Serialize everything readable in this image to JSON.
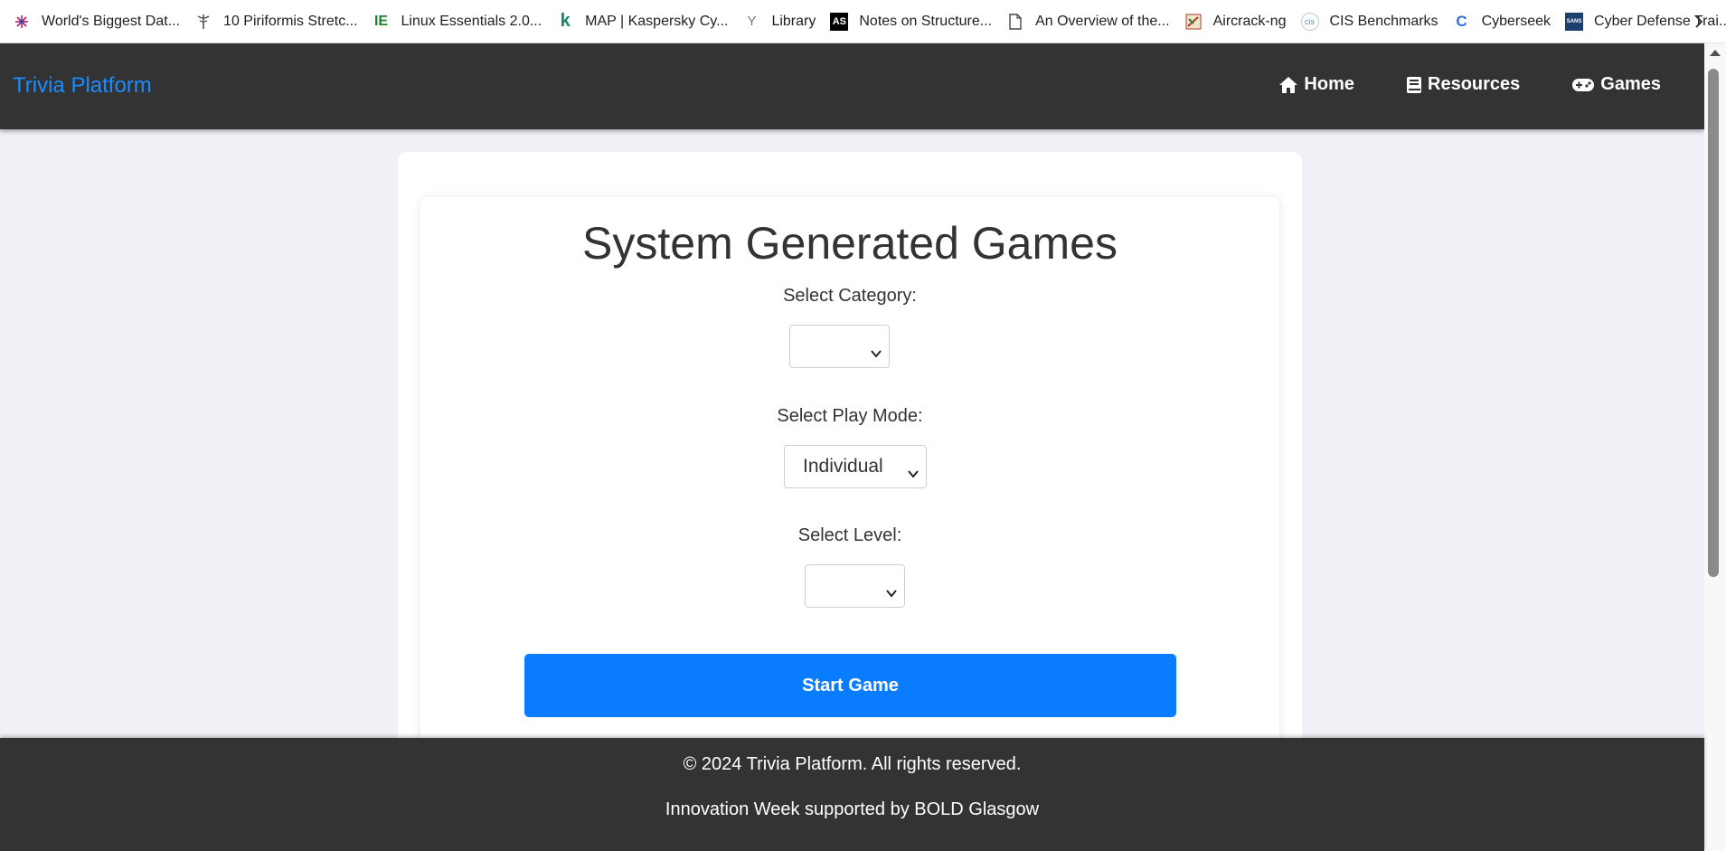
{
  "bookmarks": [
    {
      "label": "World's Biggest Dat...",
      "icon": "starburst-icon",
      "color": "#c2185b"
    },
    {
      "label": "10 Piriformis Stretc...",
      "icon": "caduceus-icon",
      "color": "#555555"
    },
    {
      "label": "Linux Essentials 2.0...",
      "icon": "ie-logo-icon",
      "color": "#1b7f2e"
    },
    {
      "label": "MAP | Kaspersky Cy...",
      "icon": "kaspersky-k-icon",
      "color": "#0f8a6e"
    },
    {
      "label": "Library",
      "icon": "y-logo-icon",
      "color": "#777777"
    },
    {
      "label": "Notes on Structure...",
      "icon": "as-logo-icon",
      "color": "#000000"
    },
    {
      "label": "An Overview of the...",
      "icon": "document-icon",
      "color": "#555555"
    },
    {
      "label": "Aircrack-ng",
      "icon": "aircrack-icon",
      "color": "#b33a2a"
    },
    {
      "label": "CIS Benchmarks",
      "icon": "cis-logo-icon",
      "color": "#6a8fa8"
    },
    {
      "label": "Cyberseek",
      "icon": "cyberseek-c-icon",
      "color": "#2f6fd6"
    },
    {
      "label": "Cyber Defense Trai...",
      "icon": "sans-logo-icon",
      "color": "#1d3f6e"
    }
  ],
  "bookmark_icon_text": {
    "ie": "IE",
    "k": "k",
    "y": "Y",
    "as": "AS",
    "cis": "cis",
    "c": "C",
    "sans": "SANS"
  },
  "nav": {
    "brand": "Trivia Platform",
    "brand_color": "#1a8cff",
    "links": [
      {
        "label": "Home",
        "icon": "home-icon"
      },
      {
        "label": "Resources",
        "icon": "book-icon"
      },
      {
        "label": "Games",
        "icon": "gamepad-icon"
      }
    ]
  },
  "main": {
    "title": "System Generated Games",
    "category": {
      "label": "Select Category:",
      "value": ""
    },
    "play_mode": {
      "label": "Select Play Mode:",
      "value": "Individual"
    },
    "level": {
      "label": "Select Level:",
      "value": ""
    },
    "start_button": "Start Game",
    "accent_color": "#0a7cff"
  },
  "footer": {
    "copyright": "© 2024 Trivia Platform. All rights reserved.",
    "credit": "Innovation Week supported by BOLD Glasgow"
  }
}
